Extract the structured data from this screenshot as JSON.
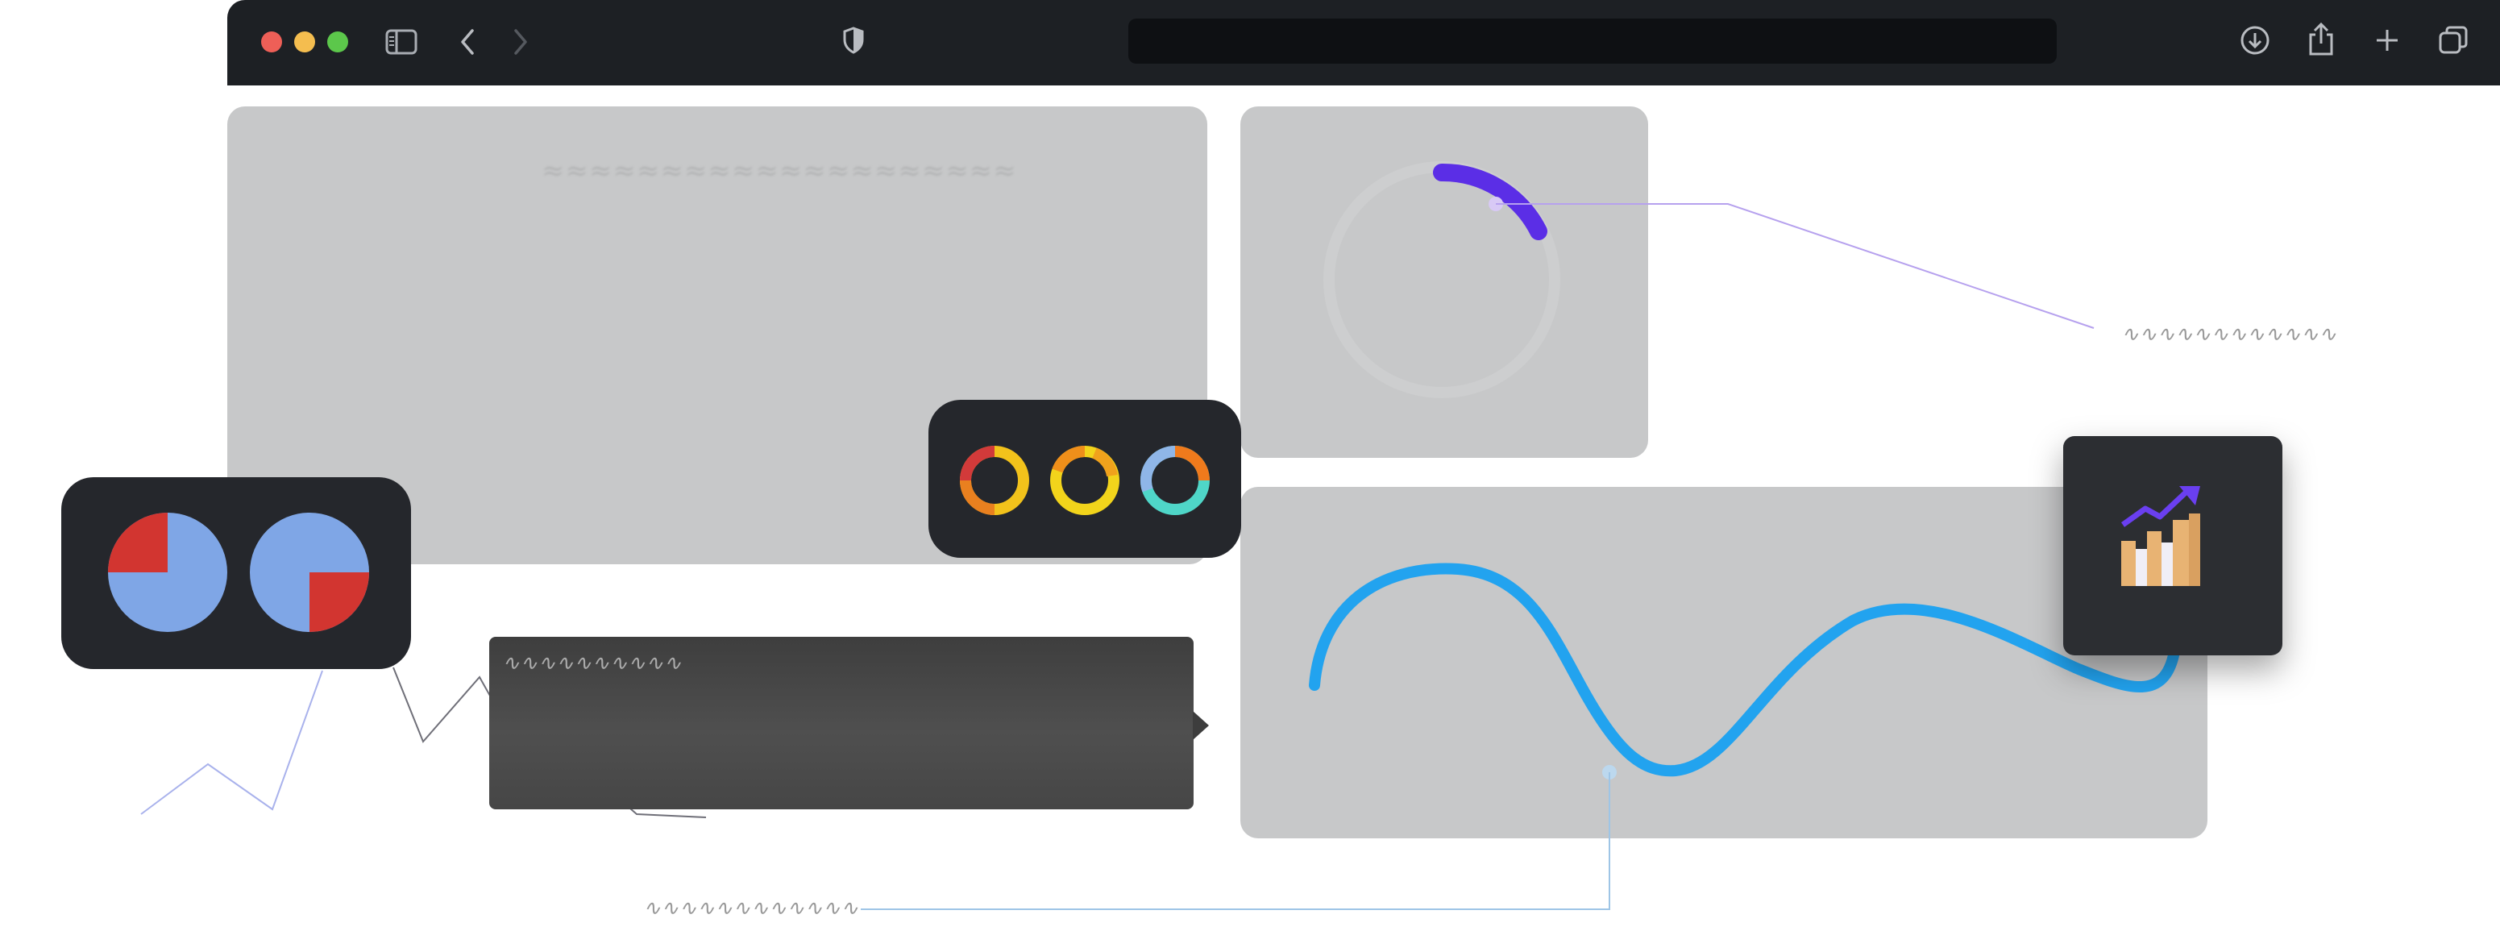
{
  "browser": {
    "address_value": "",
    "icons": [
      "sidebar-icon",
      "back-icon",
      "forward-icon",
      "shield-icon",
      "download-icon",
      "share-icon",
      "new-tab-icon",
      "tabs-overview-icon"
    ]
  },
  "colors": {
    "chrome_bar": "#1d2024",
    "card_bg": "#c7c8c9",
    "wave_blue": "#22a3ef",
    "arc_purple": "#5b2ee6",
    "pie_blue": "#7fa6e6",
    "pie_red": "#d23530",
    "connector_purple": "#b6a1ee",
    "connector_blue": "#9ec5e6"
  },
  "decor": {
    "pie_icons": [
      "pie-chart-quarter-top-left-icon",
      "pie-chart-quarter-bottom-right-icon"
    ],
    "ring_icons": [
      "ring-red-yellow-icon",
      "ring-orange-yellow-icon",
      "ring-blue-teal-icon"
    ],
    "growth_icon": "bar-chart-trend-up-icon"
  }
}
